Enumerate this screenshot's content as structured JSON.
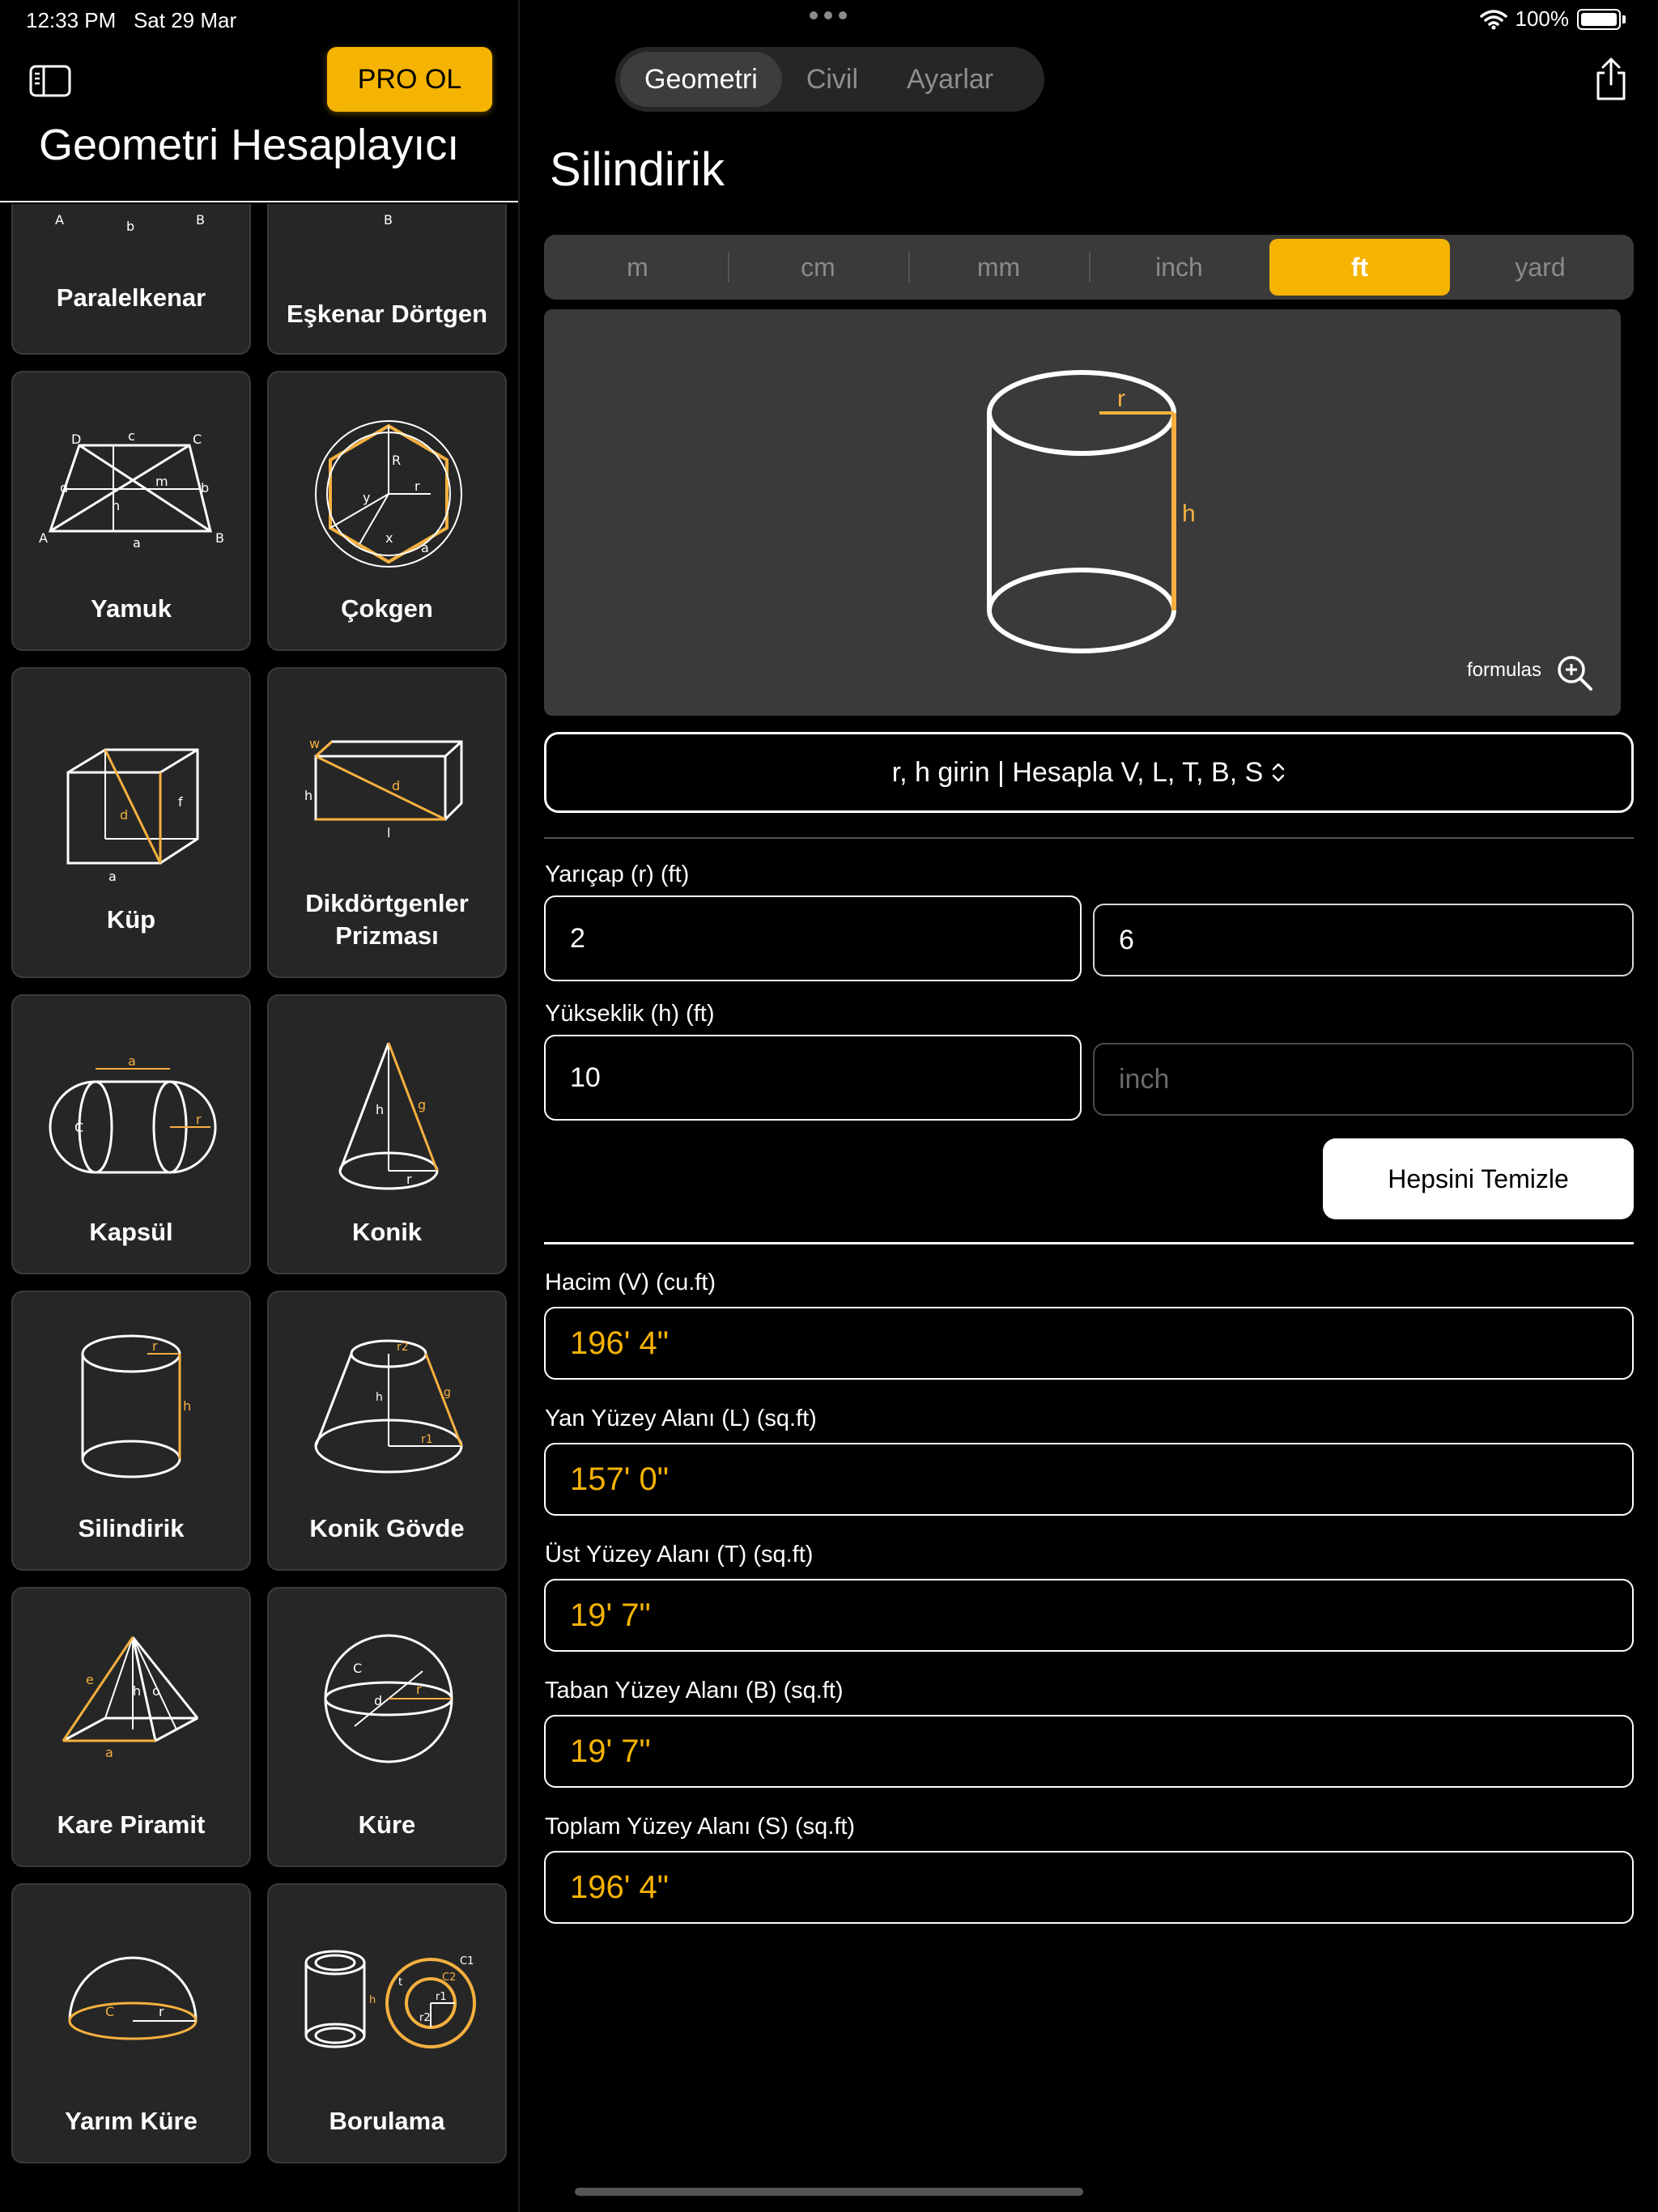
{
  "status": {
    "time": "12:33 PM",
    "date": "Sat 29 Mar",
    "battery": "100%"
  },
  "sidebar": {
    "pro_label": "PRO OL",
    "title": "Geometri Hesaplayıcı",
    "shapes": [
      {
        "label": "Paralelkenar",
        "icon": "parallelogram-icon"
      },
      {
        "label": "Eşkenar Dörtgen",
        "icon": "rhombus-icon"
      },
      {
        "label": "Yamuk",
        "icon": "trapezoid-icon"
      },
      {
        "label": "Çokgen",
        "icon": "polygon-icon"
      },
      {
        "label": "Küp",
        "icon": "cube-icon"
      },
      {
        "label": "Dikdörtgenler Prizması",
        "icon": "rectangular-prism-icon"
      },
      {
        "label": "Kapsül",
        "icon": "capsule-icon"
      },
      {
        "label": "Konik",
        "icon": "cone-icon"
      },
      {
        "label": "Silindirik",
        "icon": "cylinder-icon"
      },
      {
        "label": "Konik Gövde",
        "icon": "frustum-icon"
      },
      {
        "label": "Kare Piramit",
        "icon": "square-pyramid-icon"
      },
      {
        "label": "Küre",
        "icon": "sphere-icon"
      },
      {
        "label": "Yarım Küre",
        "icon": "hemisphere-icon"
      },
      {
        "label": "Borulama",
        "icon": "pipe-icon"
      }
    ]
  },
  "tabs": [
    {
      "label": "Geometri",
      "active": true
    },
    {
      "label": "Civil",
      "active": false
    },
    {
      "label": "Ayarlar",
      "active": false
    }
  ],
  "page_title": "Silindirik",
  "units": [
    {
      "label": "m",
      "active": false
    },
    {
      "label": "cm",
      "active": false
    },
    {
      "label": "mm",
      "active": false
    },
    {
      "label": "inch",
      "active": false
    },
    {
      "label": "ft",
      "active": true
    },
    {
      "label": "yard",
      "active": false
    }
  ],
  "figure": {
    "radius_label": "r",
    "height_label": "h",
    "formulas_label": "formulas"
  },
  "mode": "r, h girin | Hesapla V, L, T, B, S",
  "inputs": {
    "radius": {
      "label": "Yarıçap (r) (ft)",
      "ft_value": "2",
      "inch_value": "6"
    },
    "height": {
      "label": "Yükseklik (h) (ft)",
      "ft_value": "10",
      "inch_placeholder": "inch"
    }
  },
  "clear_label": "Hepsini Temizle",
  "results": [
    {
      "label": "Hacim (V) (cu.ft)",
      "value": "196' 4\""
    },
    {
      "label": "Yan Yüzey Alanı (L) (sq.ft)",
      "value": "157' 0\""
    },
    {
      "label": "Üst Yüzey Alanı (T) (sq.ft)",
      "value": "19' 7\""
    },
    {
      "label": "Taban Yüzey Alanı (B) (sq.ft)",
      "value": "19' 7\""
    },
    {
      "label": "Toplam Yüzey Alanı (S) (sq.ft)",
      "value": "196' 4\""
    }
  ],
  "colors": {
    "accent": "#f5b302",
    "tile_bg": "#262626",
    "panel_bg": "#3a3a3a"
  }
}
